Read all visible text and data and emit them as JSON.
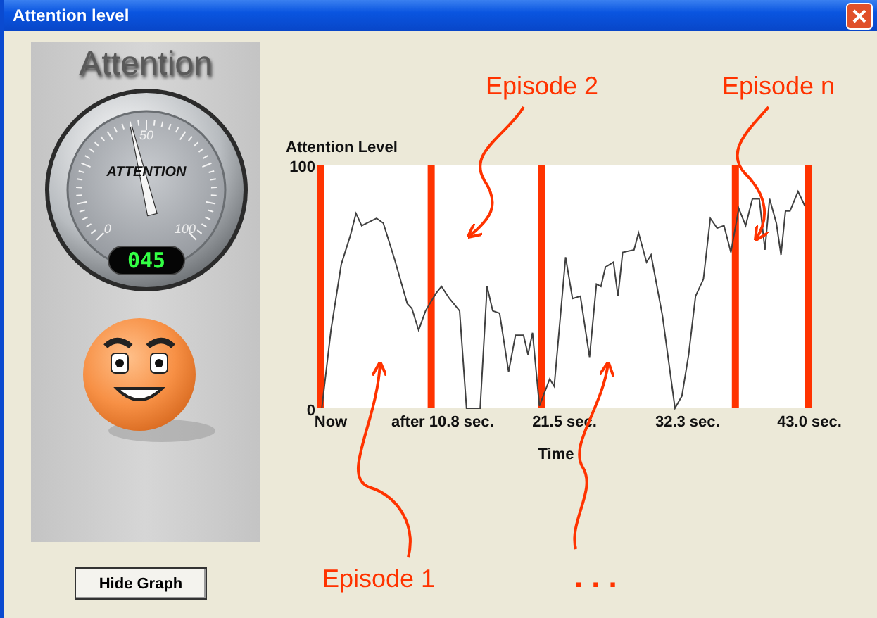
{
  "window": {
    "title": "Attention level"
  },
  "left_panel": {
    "title": "Attention",
    "gauge": {
      "dial_label": "ATTENTION",
      "scale_labels": [
        "0",
        "50",
        "100"
      ],
      "level": 0.45,
      "reading": "045"
    }
  },
  "chart": {
    "chart_data": {
      "type": "line",
      "xlabel": "Time",
      "x": [
        0.2,
        1.0,
        1.9,
        2.7,
        3.2,
        3.7,
        5.0,
        5.6,
        6.6,
        7.7,
        8.1,
        8.7,
        9.3,
        10.2,
        10.7,
        11.4,
        12.3,
        12.9,
        14.1,
        14.7,
        15.2,
        15.8,
        16.6,
        17.2,
        17.9,
        18.3,
        18.7,
        19.3,
        20.2,
        20.6,
        21.6,
        22.2,
        22.9,
        23.7,
        24.3,
        24.7,
        25.1,
        25.8,
        26.2,
        26.6,
        27.6,
        28.0,
        28.7,
        29.1,
        30.1,
        31.2,
        31.8,
        32.4,
        33.0,
        33.7,
        34.3,
        34.9,
        35.5,
        36.1,
        36.8,
        37.4,
        38.0,
        38.6,
        39.1,
        39.5,
        40.1,
        40.5,
        40.9,
        41.3,
        42.0,
        42.6
      ],
      "series": [
        {
          "name": "Attention Level",
          "color": "#404040",
          "values": [
            0,
            32,
            59,
            71,
            80,
            75,
            78,
            76,
            61,
            43,
            41,
            32,
            40,
            47,
            50,
            45,
            40,
            0,
            0,
            50,
            40,
            39,
            15,
            30,
            30,
            22,
            31,
            1,
            12,
            9,
            62,
            45,
            46,
            21,
            51,
            50,
            58,
            60,
            46,
            64,
            65,
            72,
            60,
            63,
            38,
            0,
            5,
            22,
            46,
            53,
            78,
            74,
            75,
            64,
            82,
            75,
            86,
            86,
            65,
            86,
            76,
            63,
            81,
            81,
            89,
            83
          ]
        }
      ],
      "xlim": [
        0,
        43
      ],
      "ylim": [
        0,
        100
      ],
      "xticks": [
        {
          "value": 0,
          "label": "Now"
        },
        {
          "value": 10.8,
          "label": "after 10.8 sec."
        },
        {
          "value": 21.5,
          "label": "21.5 sec."
        },
        {
          "value": 32.3,
          "label": "32.3 sec."
        },
        {
          "value": 43,
          "label": "43.0 sec."
        }
      ],
      "yticks": [
        0,
        100
      ],
      "ref_lines": [
        {
          "axis": "x",
          "value": 0.1,
          "color": "#ff3300"
        },
        {
          "axis": "x",
          "value": 9.8,
          "color": "#ff3300"
        },
        {
          "axis": "x",
          "value": 19.5,
          "color": "#ff3300"
        },
        {
          "axis": "x",
          "value": 36.5,
          "color": "#ff3300"
        },
        {
          "axis": "x",
          "value": 42.9,
          "color": "#ff3300"
        }
      ]
    }
  },
  "buttons": [
    {
      "label": "Hide Graph"
    }
  ],
  "annotations": [
    {
      "text": "Episode 2"
    },
    {
      "text": "Episode n"
    },
    {
      "text": "Episode 1"
    },
    {
      "text": "..."
    }
  ]
}
